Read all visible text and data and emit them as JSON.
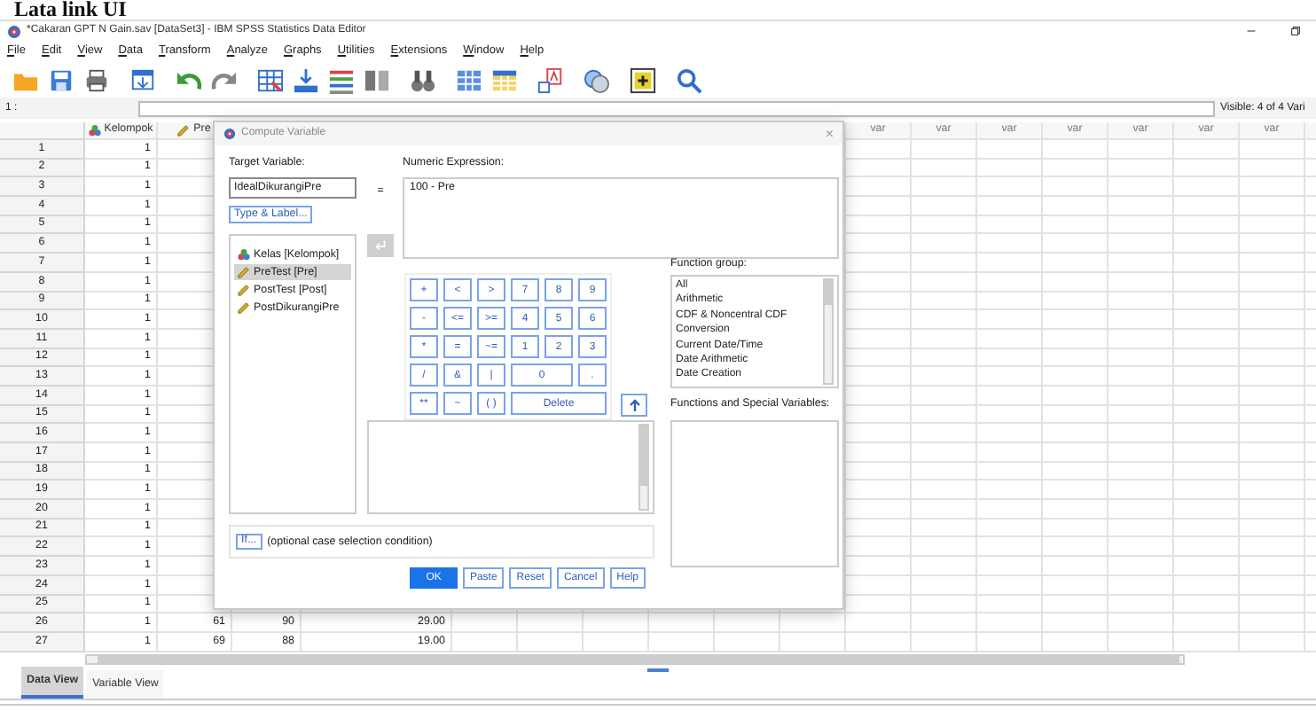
{
  "heading": "Lata link UI",
  "window": {
    "title": "*Cakaran GPT N Gain.sav [DataSet3] - IBM SPSS Statistics Data Editor"
  },
  "menu": [
    "File",
    "Edit",
    "View",
    "Data",
    "Transform",
    "Analyze",
    "Graphs",
    "Utilities",
    "Extensions",
    "Window",
    "Help"
  ],
  "formula_bar": {
    "cell": "1 :",
    "visible": "Visible: 4 of 4 Vari"
  },
  "grid": {
    "headers": [
      {
        "label": "Kelompok",
        "kind": "nominal"
      },
      {
        "label": "Pre",
        "kind": "scale"
      }
    ],
    "var_headers": [
      "var",
      "var",
      "var",
      "var",
      "var",
      "var",
      "var"
    ],
    "rows": [
      {
        "n": "1",
        "cells": [
          "1"
        ]
      },
      {
        "n": "2",
        "cells": [
          "1"
        ]
      },
      {
        "n": "3",
        "cells": [
          "1"
        ]
      },
      {
        "n": "4",
        "cells": [
          "1"
        ]
      },
      {
        "n": "5",
        "cells": [
          "1"
        ]
      },
      {
        "n": "6",
        "cells": [
          "1"
        ]
      },
      {
        "n": "7",
        "cells": [
          "1"
        ]
      },
      {
        "n": "8",
        "cells": [
          "1"
        ]
      },
      {
        "n": "9",
        "cells": [
          "1"
        ]
      },
      {
        "n": "10",
        "cells": [
          "1"
        ]
      },
      {
        "n": "11",
        "cells": [
          "1"
        ]
      },
      {
        "n": "12",
        "cells": [
          "1"
        ]
      },
      {
        "n": "13",
        "cells": [
          "1"
        ]
      },
      {
        "n": "14",
        "cells": [
          "1"
        ]
      },
      {
        "n": "15",
        "cells": [
          "1"
        ]
      },
      {
        "n": "16",
        "cells": [
          "1"
        ]
      },
      {
        "n": "17",
        "cells": [
          "1"
        ]
      },
      {
        "n": "18",
        "cells": [
          "1"
        ]
      },
      {
        "n": "19",
        "cells": [
          "1"
        ]
      },
      {
        "n": "20",
        "cells": [
          "1"
        ]
      },
      {
        "n": "21",
        "cells": [
          "1"
        ]
      },
      {
        "n": "22",
        "cells": [
          "1"
        ]
      },
      {
        "n": "23",
        "cells": [
          "1"
        ]
      },
      {
        "n": "24",
        "cells": [
          "1"
        ]
      },
      {
        "n": "25",
        "cells": [
          "1"
        ]
      },
      {
        "n": "26",
        "cells": [
          "1",
          "61",
          "90",
          "29.00"
        ]
      },
      {
        "n": "27",
        "cells": [
          "1",
          "69",
          "88",
          "19.00"
        ]
      }
    ]
  },
  "tabs": [
    {
      "label": "Data View",
      "selected": true
    },
    {
      "label": "Variable View",
      "selected": false
    }
  ],
  "dialog": {
    "title": "Compute Variable",
    "close": "×",
    "target_label": "Target Variable:",
    "target_value": "IdealDikurangiPre",
    "type_label_button": "Type & Label...",
    "equals": "=",
    "variables": [
      {
        "label": "Kelas [Kelompok]",
        "kind": "nominal",
        "selected": false
      },
      {
        "label": "PreTest [Pre]",
        "kind": "scale",
        "selected": true
      },
      {
        "label": "PostTest [Post]",
        "kind": "scale",
        "selected": false
      },
      {
        "label": "PostDikurangiPre",
        "kind": "scale",
        "selected": false
      }
    ],
    "expression_label": "Numeric Expression:",
    "expression": "100 - Pre",
    "keypad": [
      [
        "+",
        "<",
        ">",
        "7",
        "8",
        "9"
      ],
      [
        "-",
        "<=",
        ">=",
        "4",
        "5",
        "6"
      ],
      [
        "*",
        "=",
        "~=",
        "1",
        "2",
        "3"
      ],
      [
        "/",
        "&",
        "|",
        "0",
        "."
      ],
      [
        "**",
        "~",
        "( )",
        "Delete"
      ]
    ],
    "function_group_label": "Function group:",
    "function_groups": [
      "All",
      "Arithmetic",
      "CDF & Noncentral CDF",
      "Conversion",
      "Current Date/Time",
      "Date Arithmetic",
      "Date Creation"
    ],
    "functions_label": "Functions and Special Variables:",
    "if_button": "If...",
    "if_condition": "(optional case selection condition)",
    "buttons": [
      {
        "label": "OK",
        "kind": "primary"
      },
      {
        "label": "Paste",
        "kind": "plain"
      },
      {
        "label": "Reset",
        "kind": "plain"
      },
      {
        "label": "Cancel",
        "kind": "plain"
      },
      {
        "label": "Help",
        "kind": "plain"
      }
    ]
  }
}
